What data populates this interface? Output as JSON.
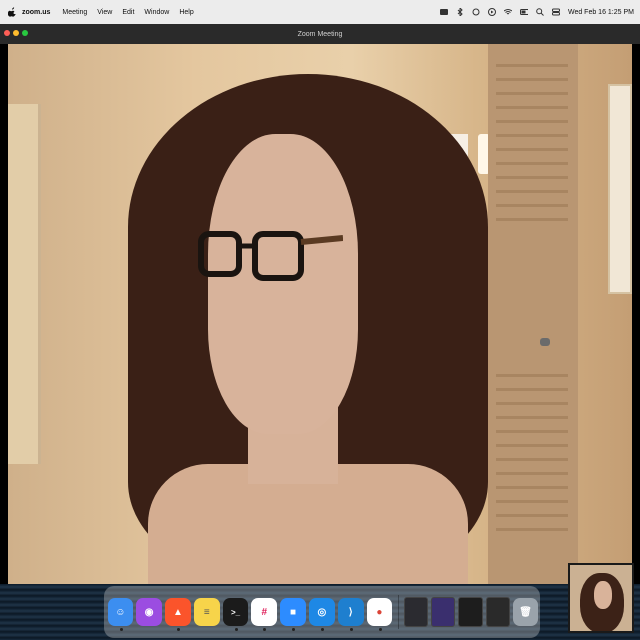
{
  "menubar": {
    "app_name": "zoom.us",
    "menus": [
      "Meeting",
      "View",
      "Edit",
      "Window",
      "Help"
    ],
    "clock": "Wed Feb 16  1:25 PM"
  },
  "window": {
    "title": "Zoom Meeting"
  },
  "dock": {
    "apps": [
      {
        "name": "Finder",
        "color": "#3c8ef0",
        "glyph": "☺"
      },
      {
        "name": "Podcasts",
        "color": "#9b4de1",
        "glyph": "◉"
      },
      {
        "name": "Brave",
        "color": "#fb542b",
        "glyph": "▲"
      },
      {
        "name": "Notes",
        "color": "#f7d44a",
        "glyph": "≡"
      },
      {
        "name": "Terminal",
        "color": "#1b1b1b",
        "glyph": ">_"
      },
      {
        "name": "Slack",
        "color": "#ffffff",
        "glyph": "#"
      },
      {
        "name": "Zoom",
        "color": "#2d8cff",
        "glyph": "■"
      },
      {
        "name": "Safari",
        "color": "#1e88e5",
        "glyph": "◎"
      },
      {
        "name": "VS Code",
        "color": "#1e7fcf",
        "glyph": "⟩"
      },
      {
        "name": "Chrome",
        "color": "#ffffff",
        "glyph": "●"
      }
    ]
  }
}
